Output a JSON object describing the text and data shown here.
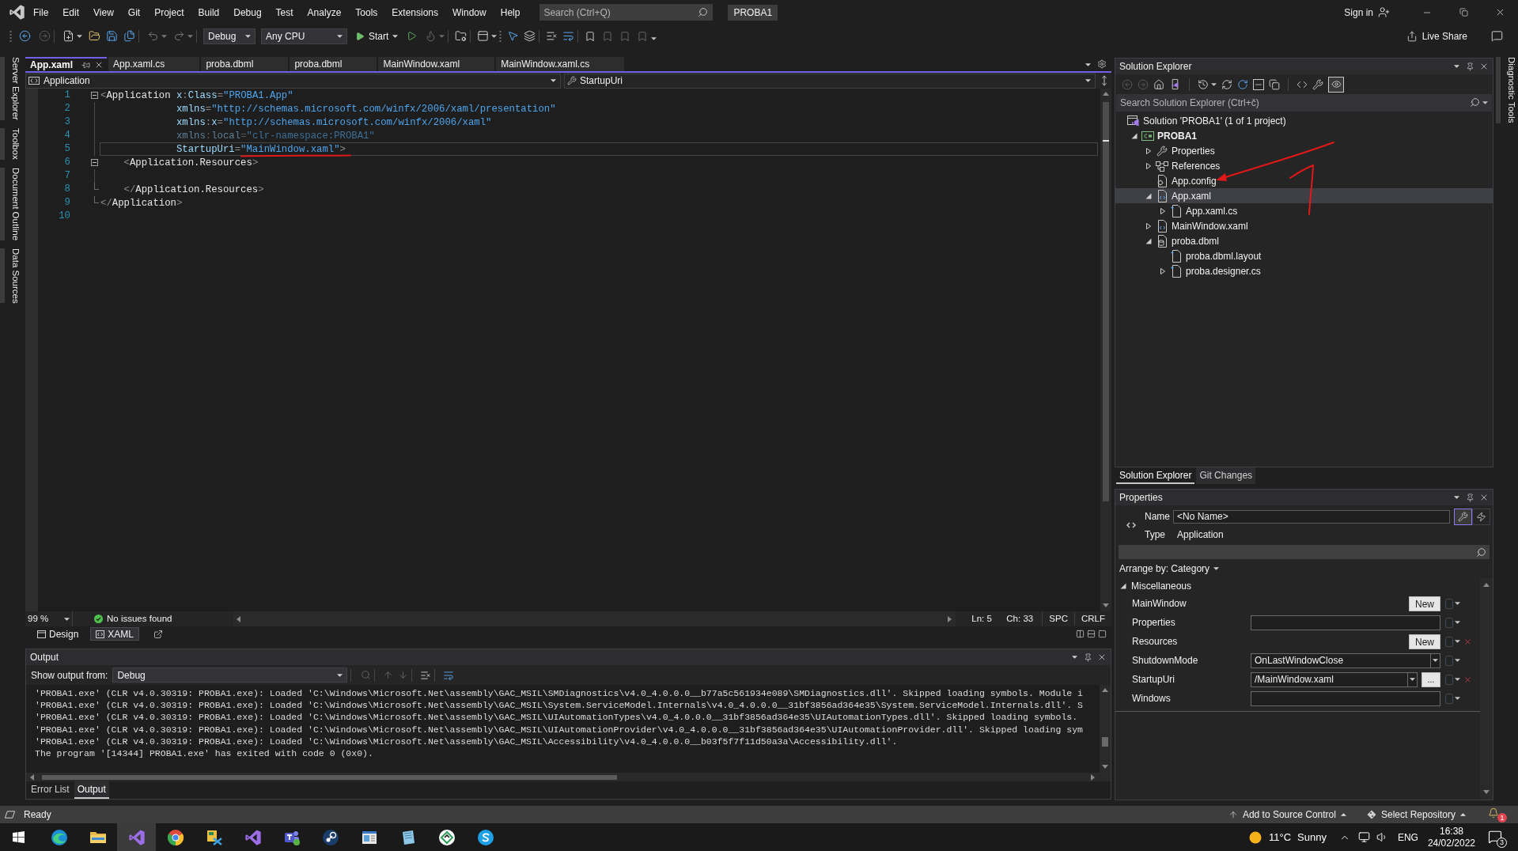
{
  "title_bar": {
    "menu": [
      "File",
      "Edit",
      "View",
      "Git",
      "Project",
      "Build",
      "Debug",
      "Test",
      "Analyze",
      "Tools",
      "Extensions",
      "Window",
      "Help"
    ],
    "search": {
      "placeholder": "Search (Ctrl+Q)"
    },
    "solution_name": "PROBA1",
    "sign_in": "Sign in"
  },
  "toolbar": {
    "configuration": "Debug",
    "platform": "Any CPU",
    "start": "Start",
    "live_share": "Live Share"
  },
  "left_tool_tabs": [
    "Server Explorer",
    "Toolbox",
    "Document Outline",
    "Data Sources"
  ],
  "editor": {
    "tabs": [
      {
        "label": "App.xaml",
        "selected": true
      },
      {
        "label": "App.xaml.cs",
        "selected": false
      },
      {
        "label": "proba.dbml",
        "selected": false
      },
      {
        "label": "proba.dbml",
        "selected": false
      },
      {
        "label": "MainWindow.xaml",
        "selected": false
      },
      {
        "label": "MainWindow.xaml.cs",
        "selected": false
      }
    ],
    "scope": "Application",
    "member": "StartupUri",
    "lines": [
      {
        "number": "1",
        "kind": "fold_start",
        "current": false,
        "faded": false,
        "tokens": [
          {
            "kind": "delim",
            "text": "<"
          },
          {
            "kind": "element",
            "text": "Application"
          },
          {
            "kind": "attr",
            "text": " x"
          },
          {
            "kind": "delim",
            "text": ":"
          },
          {
            "kind": "attr",
            "text": "Class"
          },
          {
            "kind": "delim",
            "text": "="
          },
          {
            "kind": "value",
            "text": "\"PROBA1.App\""
          }
        ]
      },
      {
        "number": "2",
        "kind": "fold_inner",
        "current": false,
        "faded": false,
        "tokens": [
          {
            "kind": "attr",
            "text": "             xmlns"
          },
          {
            "kind": "delim",
            "text": "="
          },
          {
            "kind": "value",
            "text": "\"http://schemas.microsoft.com/winfx/2006/xaml/presentation\""
          }
        ]
      },
      {
        "number": "3",
        "kind": "fold_inner",
        "current": false,
        "faded": false,
        "tokens": [
          {
            "kind": "attr",
            "text": "             xmlns"
          },
          {
            "kind": "delim",
            "text": ":"
          },
          {
            "kind": "attr",
            "text": "x"
          },
          {
            "kind": "delim",
            "text": "="
          },
          {
            "kind": "value",
            "text": "\"http://schemas.microsoft.com/winfx/2006/xaml\""
          }
        ]
      },
      {
        "number": "4",
        "kind": "fold_inner",
        "current": false,
        "faded": true,
        "tokens": [
          {
            "kind": "attr",
            "text": "             xmlns"
          },
          {
            "kind": "delim",
            "text": ":"
          },
          {
            "kind": "attr",
            "text": "local"
          },
          {
            "kind": "delim",
            "text": "="
          },
          {
            "kind": "value",
            "text": "\"clr-namespace:PROBA1\""
          }
        ]
      },
      {
        "number": "5",
        "kind": "fold_inner",
        "current": true,
        "faded": false,
        "tokens": [
          {
            "kind": "attr",
            "text": "             StartupUri"
          },
          {
            "kind": "delim",
            "text": "="
          },
          {
            "kind": "value",
            "text": "\"MainWindow.xaml\""
          },
          {
            "kind": "delim",
            "text": ">"
          }
        ]
      },
      {
        "number": "6",
        "kind": "fold_start",
        "current": false,
        "faded": false,
        "tokens": [
          {
            "kind": "delim",
            "text": "    <"
          },
          {
            "kind": "element",
            "text": "Application.Resources"
          },
          {
            "kind": "delim",
            "text": ">"
          }
        ]
      },
      {
        "number": "7",
        "kind": "fold_inner",
        "current": false
      },
      {
        "number": "8",
        "kind": "fold_end",
        "current": false,
        "faded": false,
        "tokens": [
          {
            "kind": "delim",
            "text": "    </"
          },
          {
            "kind": "element",
            "text": "Application.Resources"
          },
          {
            "kind": "delim",
            "text": ">"
          }
        ]
      },
      {
        "number": "9",
        "kind": "fold_end",
        "current": false,
        "faded": false,
        "tokens": [
          {
            "kind": "delim",
            "text": "</"
          },
          {
            "kind": "element",
            "text": "Application"
          },
          {
            "kind": "delim",
            "text": ">"
          }
        ]
      },
      {
        "number": "10",
        "kind": "plain",
        "current": false
      }
    ],
    "zoom": "99 %",
    "issues": "No issues found",
    "line": "Ln: 5",
    "column": "Ch: 33",
    "indentation": "SPC",
    "line_ending": "CRLF",
    "view_tabs": [
      {
        "label": "Design",
        "kind": "design",
        "selected": false
      },
      {
        "label": "XAML",
        "kind": "xaml",
        "selected": true
      }
    ]
  },
  "output": {
    "title": "Output",
    "source_label": "Show output from:",
    "source": "Debug",
    "lines": [
      "'PROBA1.exe' (CLR v4.0.30319: PROBA1.exe): Loaded 'C:\\Windows\\Microsoft.Net\\assembly\\GAC_MSIL\\SMDiagnostics\\v4.0_4.0.0.0__b77a5c561934e089\\SMDiagnostics.dll'. Skipped loading symbols. Module i",
      "'PROBA1.exe' (CLR v4.0.30319: PROBA1.exe): Loaded 'C:\\Windows\\Microsoft.Net\\assembly\\GAC_MSIL\\System.ServiceModel.Internals\\v4.0_4.0.0.0__31bf3856ad364e35\\System.ServiceModel.Internals.dll'. S",
      "'PROBA1.exe' (CLR v4.0.30319: PROBA1.exe): Loaded 'C:\\Windows\\Microsoft.Net\\assembly\\GAC_MSIL\\UIAutomationTypes\\v4.0_4.0.0.0__31bf3856ad364e35\\UIAutomationTypes.dll'. Skipped loading symbols.",
      "'PROBA1.exe' (CLR v4.0.30319: PROBA1.exe): Loaded 'C:\\Windows\\Microsoft.Net\\assembly\\GAC_MSIL\\UIAutomationProvider\\v4.0_4.0.0.0__31bf3856ad364e35\\UIAutomationProvider.dll'. Skipped loading sym",
      "'PROBA1.exe' (CLR v4.0.30319: PROBA1.exe): Loaded 'C:\\Windows\\Microsoft.Net\\assembly\\GAC_MSIL\\Accessibility\\v4.0_4.0.0.0__b03f5f7f11d50a3a\\Accessibility.dll'.",
      "The program '[14344] PROBA1.exe' has exited with code 0 (0x0)."
    ]
  },
  "bottom_tabs": [
    {
      "label": "Error List",
      "selected": false
    },
    {
      "label": "Output",
      "selected": true
    }
  ],
  "solution_explorer": {
    "title": "Solution Explorer",
    "search": {
      "placeholder": "Search Solution Explorer (Ctrl+č)"
    },
    "tree": [
      {
        "label": "Solution 'PROBA1' (1 of 1 project)",
        "kind": "solution",
        "selected": false,
        "children": [
          {
            "label": "PROBA1",
            "kind": "project",
            "expanded": true,
            "selected": false,
            "children": [
              {
                "label": "Properties",
                "kind": "properties",
                "expanded": false,
                "selected": false
              },
              {
                "label": "References",
                "kind": "references",
                "expanded": false,
                "selected": false
              },
              {
                "label": "App.config",
                "kind": "config",
                "selected": false
              },
              {
                "label": "App.xaml",
                "kind": "xaml",
                "expanded": true,
                "selected": true,
                "children": [
                  {
                    "label": "App.xaml.cs",
                    "kind": "code",
                    "expanded": false,
                    "selected": false
                  }
                ]
              },
              {
                "label": "MainWindow.xaml",
                "kind": "xaml",
                "expanded": false,
                "selected": false
              },
              {
                "label": "proba.dbml",
                "kind": "dbml",
                "expanded": true,
                "selected": false,
                "children": [
                  {
                    "label": "proba.dbml.layout",
                    "kind": "code",
                    "selected": false
                  },
                  {
                    "label": "proba.designer.cs",
                    "kind": "code",
                    "expanded": false,
                    "selected": false
                  }
                ]
              }
            ]
          }
        ]
      }
    ]
  },
  "panel_tabs": [
    {
      "label": "Solution Explorer",
      "selected": true
    },
    {
      "label": "Git Changes",
      "selected": false
    }
  ],
  "properties": {
    "title": "Properties",
    "name_label": "Name",
    "name": "<No Name>",
    "type_label": "Type",
    "type": "Application",
    "views": [
      {
        "kind": "properties",
        "selected": true
      },
      {
        "kind": "events",
        "selected": false
      }
    ],
    "arrange_by": "Arrange by: Category",
    "categories": [
      {
        "label": "Miscellaneous",
        "expanded": true,
        "rows": [
          {
            "name": "MainWindow",
            "kind": "button",
            "button": "New",
            "clearable": false
          },
          {
            "name": "Properties",
            "kind": "text",
            "clearable": false
          },
          {
            "name": "Resources",
            "kind": "button",
            "button": "New",
            "clearable": true
          },
          {
            "name": "ShutdownMode",
            "kind": "combo",
            "value": "OnLastWindowClose",
            "clearable": false
          },
          {
            "name": "StartupUri",
            "kind": "combo_browse",
            "value": "/MainWindow.xaml",
            "browse": "...",
            "clearable": true
          },
          {
            "name": "Windows",
            "kind": "text",
            "clearable": false
          }
        ]
      }
    ]
  },
  "right_tool_tabs": [
    "Diagnostic Tools"
  ],
  "status_bar": {
    "text": "Ready",
    "source_control": "Add to Source Control",
    "repository": "Select Repository",
    "notifications": "1"
  },
  "taskbar": {
    "apps": [
      {
        "kind": "edge",
        "active": false
      },
      {
        "kind": "explorer",
        "active": false
      },
      {
        "kind": "vs",
        "active": true
      },
      {
        "kind": "chrome",
        "active": false
      },
      {
        "kind": "tool",
        "active": false
      },
      {
        "kind": "vs",
        "active": false
      },
      {
        "kind": "teams",
        "active": false
      },
      {
        "kind": "steam",
        "active": false
      },
      {
        "kind": "window",
        "active": false
      },
      {
        "kind": "notes",
        "active": false
      },
      {
        "kind": "circle",
        "active": false
      },
      {
        "kind": "skype",
        "active": false
      }
    ],
    "temperature": "11°C",
    "weather": "Sunny",
    "language": "ENG",
    "time": "16:38",
    "date": "24/02/2022",
    "notifications": "3"
  }
}
